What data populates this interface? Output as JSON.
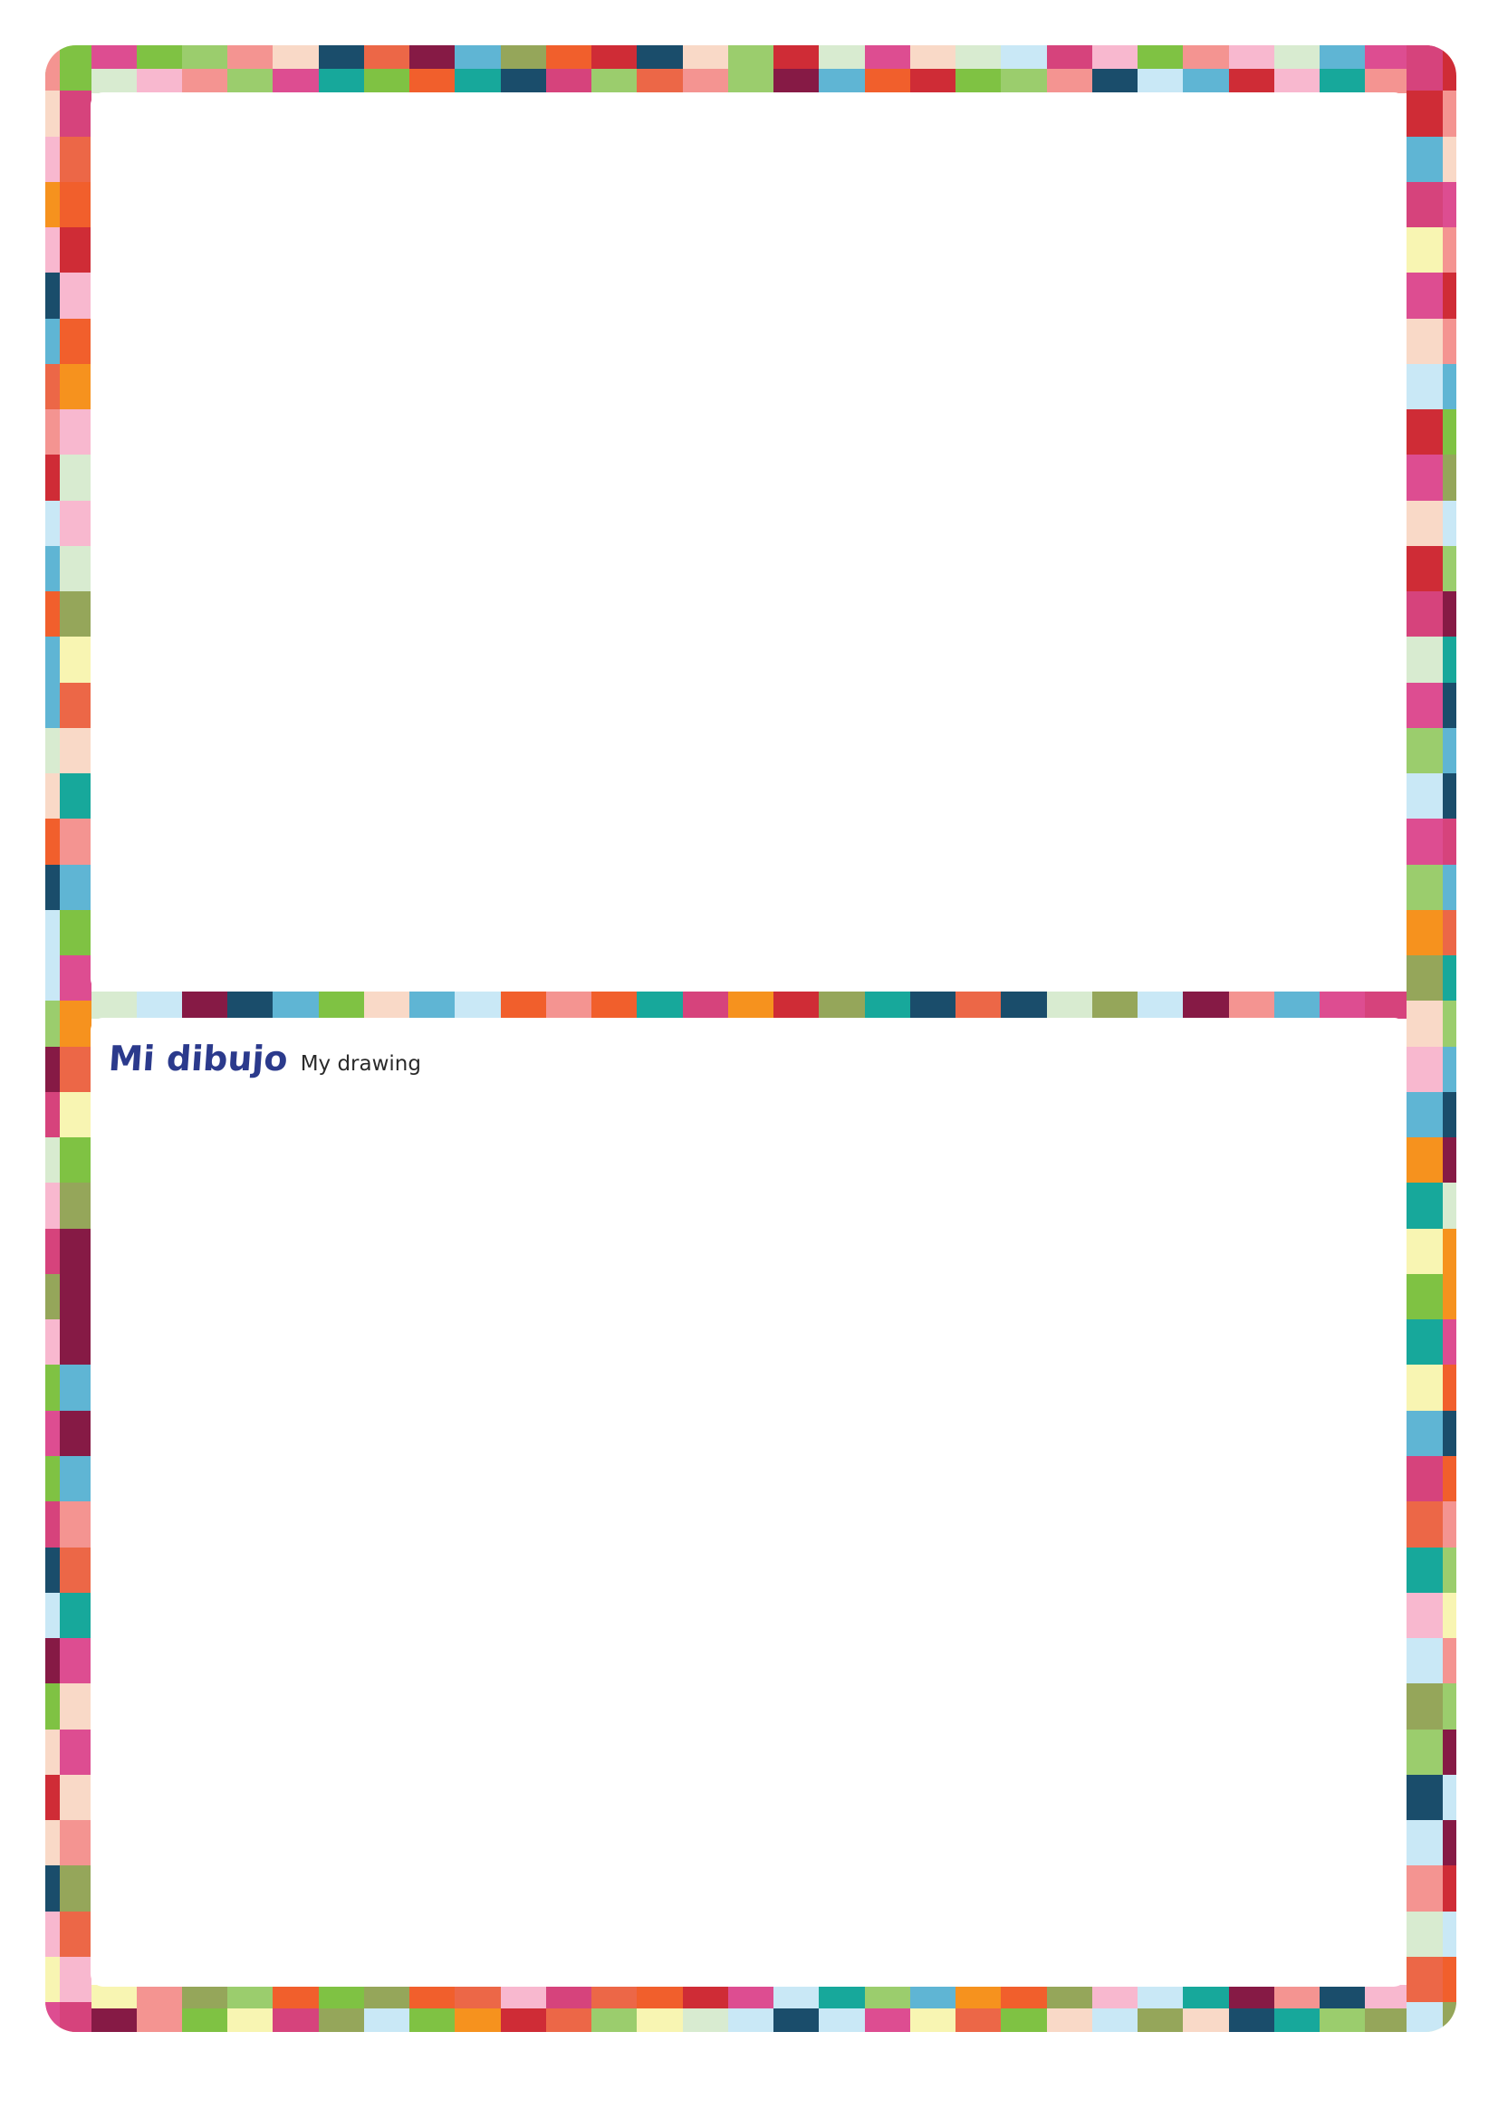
{
  "heading": {
    "title_es": "Mi dibujo",
    "title_en": "My drawing"
  },
  "colors": {
    "title": "#2b3a8c",
    "palette": [
      "#c9e8f6",
      "#1a4d6b",
      "#7fc243",
      "#d8ebd0",
      "#9bcd6d",
      "#95a65a",
      "#17a89b",
      "#5fb5d4",
      "#f49491",
      "#f9d9c7",
      "#dd4d91",
      "#861a45",
      "#cf2c36",
      "#f6921e",
      "#f15f2c",
      "#f8f5b2",
      "#ec6747",
      "#d6437c",
      "#f8b8cf"
    ]
  }
}
